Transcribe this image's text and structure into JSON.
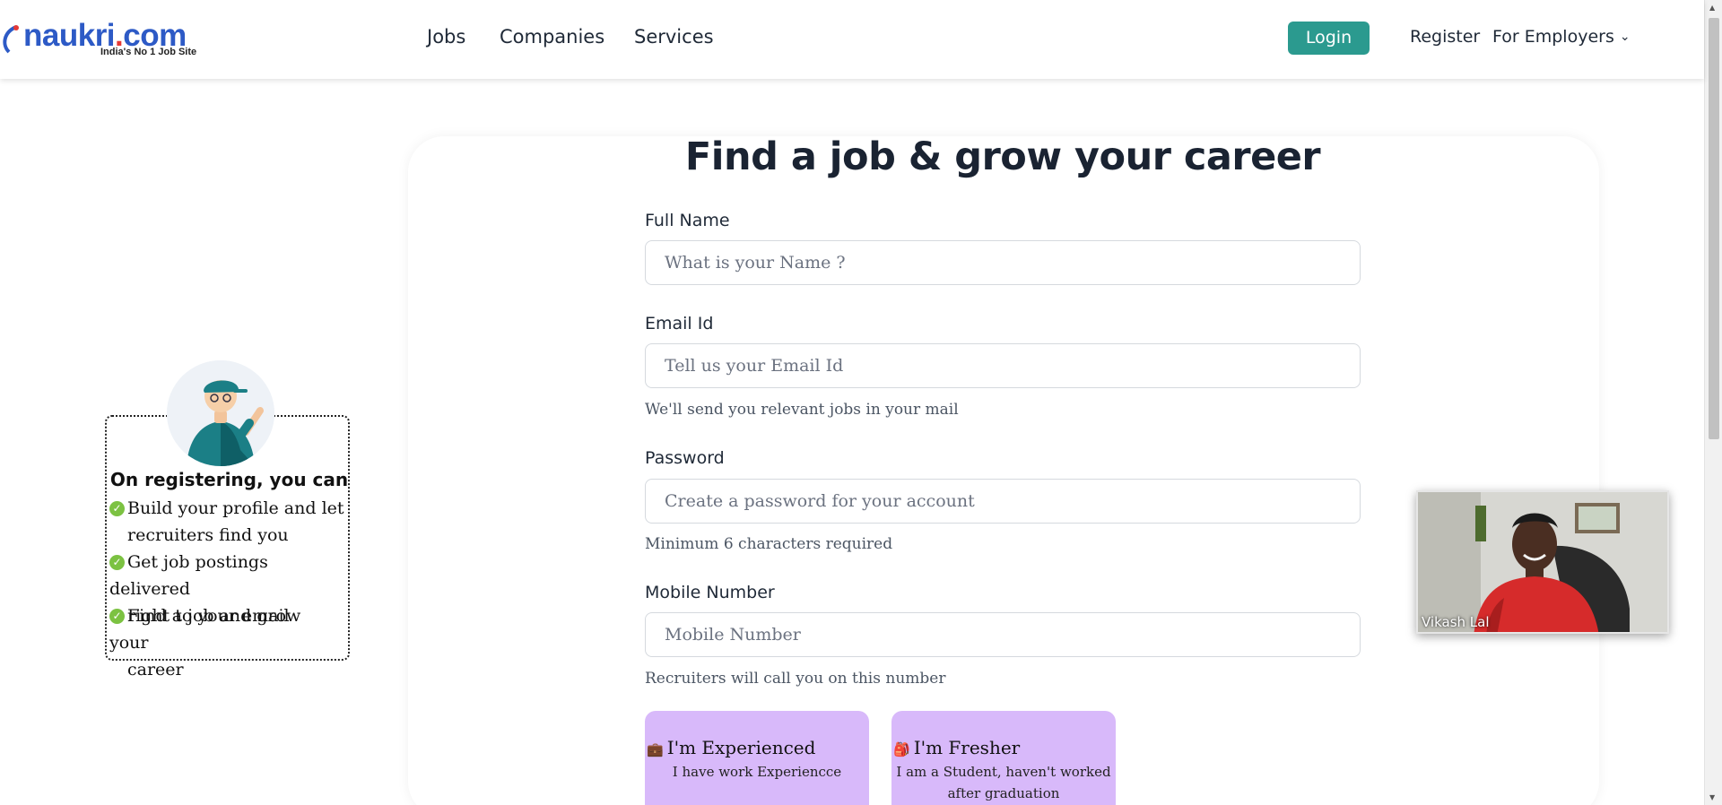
{
  "header": {
    "logo_text_main": "naukri",
    "logo_text_suffix": "com",
    "logo_tagline": "India's No 1 Job Site",
    "nav": [
      "Jobs",
      "Companies",
      "Services"
    ],
    "login_label": "Login",
    "register_label": "Register",
    "employers_label": "For Employers"
  },
  "benefits_panel": {
    "title": "On registering, you can",
    "items": [
      {
        "line1": "Build your profile and let",
        "line2": "recruiters find you"
      },
      {
        "line1": "Get job postings delivered",
        "line2": "right to your email"
      },
      {
        "line1": "Find a job and grow your",
        "line2": "career"
      }
    ]
  },
  "form": {
    "heading": "Find a job & grow your career",
    "full_name": {
      "label": "Full Name",
      "placeholder": "What is your Name ?"
    },
    "email": {
      "label": "Email Id",
      "placeholder": "Tell us your Email Id",
      "hint": "We'll send you relevant jobs in your mail"
    },
    "password": {
      "label": "Password",
      "placeholder": "Create a password for your account",
      "hint": "Minimum 6 characters required"
    },
    "mobile": {
      "label": "Mobile Number",
      "placeholder": "Mobile Number",
      "hint": "Recruiters will call you on this number"
    },
    "work_status": [
      {
        "title": "I'm Experienced",
        "subtitle": "I have work Experiencce",
        "icon": "briefcase-icon"
      },
      {
        "title": "I'm Fresher",
        "subtitle": "I am a Student, haven't worked after graduation",
        "icon": "backpack-icon"
      }
    ]
  },
  "video_call": {
    "participant_name": "Vikash Lal"
  },
  "colors": {
    "brand_blue": "#2d5ac6",
    "brand_red": "#e53935",
    "login_teal": "#2b9a8f",
    "choice_purple": "#d8b9fa",
    "check_green": "#7cc242"
  }
}
